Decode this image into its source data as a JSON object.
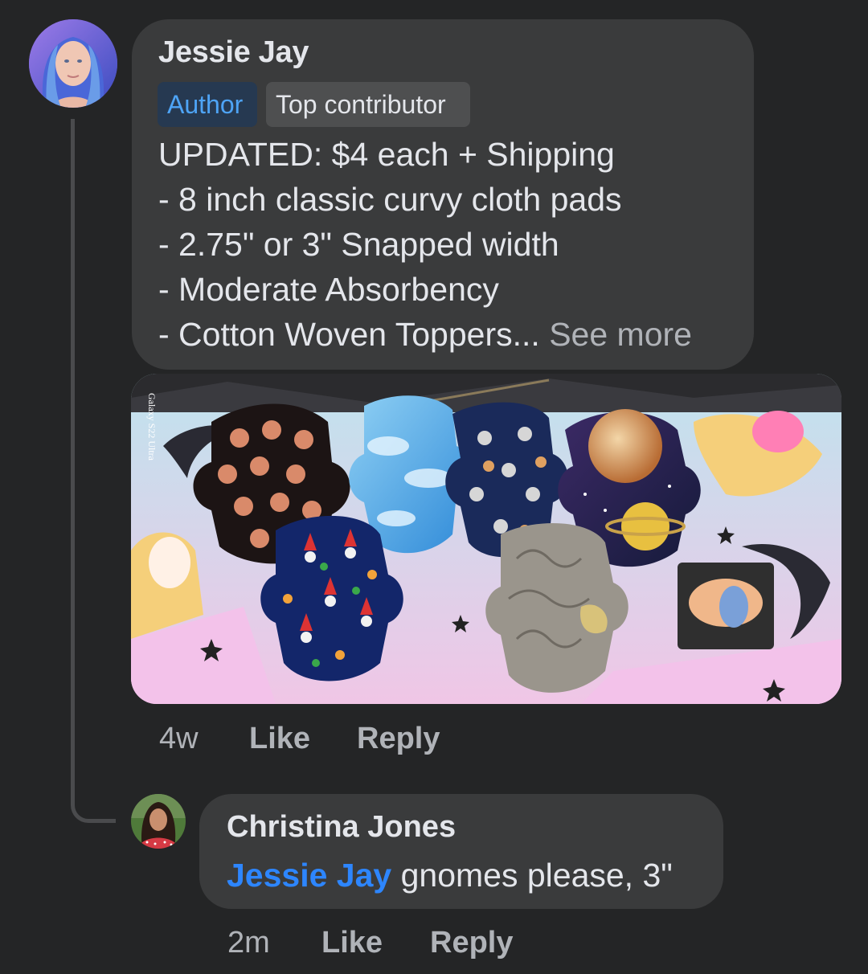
{
  "comment": {
    "author": "Jessie Jay",
    "badges": [
      "Author",
      "Top contributor"
    ],
    "lines": [
      "UPDATED: $4 each + Shipping",
      "- 8 inch classic curvy cloth pads",
      "- 2.75\" or 3\" Snapped width",
      "- Moderate Absorbency",
      "- Cotton Woven Toppers..."
    ],
    "see_more": "See more",
    "photo_watermark": "Galaxy S22 Ultra",
    "time": "4w",
    "like": "Like",
    "reply": "Reply"
  },
  "reply": {
    "author": "Christina Jones",
    "mention": "Jessie Jay",
    "text": "gnomes please, 3\"",
    "time": "2m",
    "like": "Like",
    "reply": "Reply"
  },
  "colors": {
    "background": "#242526",
    "bubble": "#3a3b3c",
    "mention": "#2d86ff",
    "author_badge_text": "#4ea4f6"
  }
}
